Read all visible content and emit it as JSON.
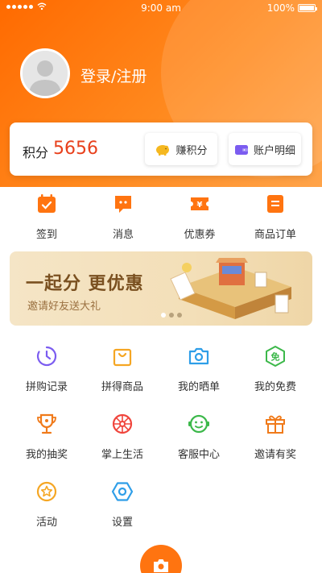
{
  "status_bar": {
    "time": "9:00 am",
    "battery": "100%"
  },
  "profile": {
    "login_label": "登录/注册"
  },
  "points": {
    "label": "积分",
    "value": "5656",
    "earn_label": "赚积分",
    "account_label": "账户明细"
  },
  "quick_menu": [
    {
      "label": "签到",
      "icon": "calendar-check-icon"
    },
    {
      "label": "消息",
      "icon": "message-icon"
    },
    {
      "label": "优惠券",
      "icon": "coupon-icon"
    },
    {
      "label": "商品订单",
      "icon": "order-icon"
    }
  ],
  "banner": {
    "title": "一起分 更优惠",
    "subtitle": "邀请好友送大礼"
  },
  "grid": [
    {
      "label": "拼购记录",
      "icon": "clock-icon",
      "color": "#7b5cf0"
    },
    {
      "label": "拼得商品",
      "icon": "shopping-bag-icon",
      "color": "#f5a623"
    },
    {
      "label": "我的晒单",
      "icon": "camera-icon",
      "color": "#2e9ee8"
    },
    {
      "label": "我的免费",
      "icon": "free-badge-icon",
      "color": "#3cb84a"
    },
    {
      "label": "我的抽奖",
      "icon": "trophy-icon",
      "color": "#f07a1a"
    },
    {
      "label": "掌上生活",
      "icon": "wheel-icon",
      "color": "#f0453c"
    },
    {
      "label": "客服中心",
      "icon": "service-icon",
      "color": "#3cb84a"
    },
    {
      "label": "邀请有奖",
      "icon": "gift-icon",
      "color": "#f07a1a"
    },
    {
      "label": "活动",
      "icon": "star-badge-icon",
      "color": "#f5a623"
    },
    {
      "label": "设置",
      "icon": "settings-hex-icon",
      "color": "#2e9ee8"
    }
  ],
  "colors": {
    "brand": "#ff7410",
    "points_value": "#e8401c"
  }
}
